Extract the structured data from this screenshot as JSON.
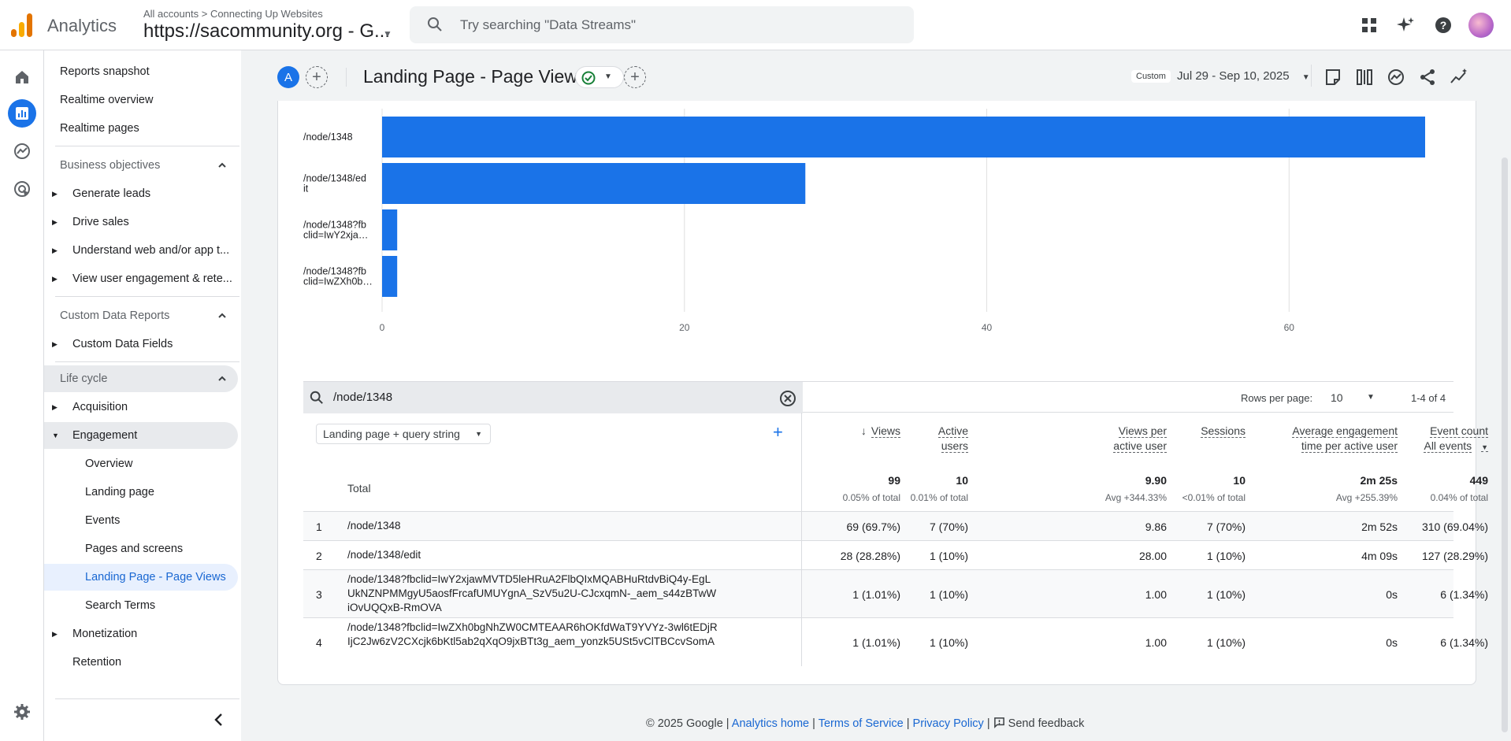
{
  "topbar": {
    "app_name": "Analytics",
    "crumb_all": "All accounts",
    "crumb_sep": ">",
    "crumb_account": "Connecting Up Websites",
    "property": "https://sacommunity.org - G...",
    "search_placeholder": "Try searching \"Data Streams\""
  },
  "sidebar": {
    "items": {
      "reports_snapshot": "Reports snapshot",
      "realtime_overview": "Realtime overview",
      "realtime_pages": "Realtime pages",
      "business_objectives": "Business objectives",
      "generate_leads": "Generate leads",
      "drive_sales": "Drive sales",
      "understand": "Understand web and/or app t...",
      "view_engagement": "View user engagement & rete...",
      "custom_reports": "Custom Data Reports",
      "custom_fields": "Custom Data Fields",
      "life_cycle": "Life cycle",
      "acquisition": "Acquisition",
      "engagement": "Engagement",
      "overview": "Overview",
      "landing_page": "Landing page",
      "events": "Events",
      "pages_screens": "Pages and screens",
      "landing_page_views": "Landing Page - Page Views",
      "search_terms": "Search Terms",
      "monetization": "Monetization",
      "retention": "Retention"
    }
  },
  "header": {
    "avatar_letter": "A",
    "title": "Landing Page - Page Views",
    "custom_tag": "Custom",
    "date_range": "Jul 29 - Sep 10, 2025"
  },
  "chart_data": {
    "type": "bar",
    "orientation": "horizontal",
    "categories": [
      "/node/1348",
      "/node/1348/edit",
      "/node/1348?fbclid=IwY2xja…",
      "/node/1348?fbclid=IwZXh0b…"
    ],
    "category_labels": [
      [
        "/node/1348"
      ],
      [
        "/node/1348/ed",
        "it"
      ],
      [
        "/node/1348?fb",
        "clid=IwY2xja…"
      ],
      [
        "/node/1348?fb",
        "clid=IwZXh0b…"
      ]
    ],
    "values": [
      69,
      28,
      1,
      1
    ],
    "xlim": [
      0,
      69
    ],
    "ticks": [
      0,
      20,
      40,
      60
    ],
    "color": "#1a73e8"
  },
  "table": {
    "search_value": "/node/1348",
    "rows_per_page_label": "Rows per page:",
    "rows_per_page": "10",
    "pagination": "1-4 of 4",
    "dimension": "Landing page + query string",
    "columns": {
      "views": "Views",
      "active_users_1": "Active",
      "active_users_2": "users",
      "vpau_1": "Views per",
      "vpau_2": "active user",
      "sessions": "Sessions",
      "aet_1": "Average engagement",
      "aet_2": "time per active user",
      "events_1": "Event count",
      "events_2": "All events"
    },
    "total": {
      "label": "Total",
      "views": "99",
      "views_sub": "0.05% of total",
      "users": "10",
      "users_sub": "0.01% of total",
      "vpau": "9.90",
      "vpau_sub": "Avg +344.33%",
      "sessions": "10",
      "sessions_sub": "<0.01% of total",
      "aet": "2m 25s",
      "aet_sub": "Avg +255.39%",
      "events": "449",
      "events_sub": "0.04% of total"
    },
    "rows": [
      {
        "idx": "1",
        "page": "/node/1348",
        "views": "69 (69.7%)",
        "users": "7 (70%)",
        "vpau": "9.86",
        "sessions": "7 (70%)",
        "aet": "2m 52s",
        "events": "310 (69.04%)"
      },
      {
        "idx": "2",
        "page": "/node/1348/edit",
        "views": "28 (28.28%)",
        "users": "1 (10%)",
        "vpau": "28.00",
        "sessions": "1 (10%)",
        "aet": "4m 09s",
        "events": "127 (28.29%)"
      },
      {
        "idx": "3",
        "page": "/node/1348?fbclid=IwY2xjawMVTD5leHRuA2FlbQIxMQABHuRtdvBiQ4y-EgLUkNZNPMMgyU5aosfFrcafUMUYgnA_SzV5u2U-CJcxqmN-_aem_s44zBTwWiOvUQQxB-RmOVA",
        "views": "1 (1.01%)",
        "users": "1 (10%)",
        "vpau": "1.00",
        "sessions": "1 (10%)",
        "aet": "0s",
        "events": "6 (1.34%)"
      },
      {
        "idx": "4",
        "page": "/node/1348?fbclid=IwZXh0bgNhZW0CMTEAAR6hOKfdWaT9YVYz-3wl6tEDjRIjC2Jw6zV2CXcjk6bKtl5ab2qXqO9jxBTt3g_aem_yonzk5USt5vClTBCcvSomA",
        "views": "1 (1.01%)",
        "users": "1 (10%)",
        "vpau": "1.00",
        "sessions": "1 (10%)",
        "aet": "0s",
        "events": "6 (1.34%)"
      }
    ]
  },
  "footer": {
    "copyright": "© 2025 Google |",
    "home": "Analytics home",
    "sep1": "|",
    "terms": "Terms of Service",
    "sep2": "|",
    "privacy": "Privacy Policy",
    "sep3": "|",
    "feedback": "Send feedback"
  }
}
